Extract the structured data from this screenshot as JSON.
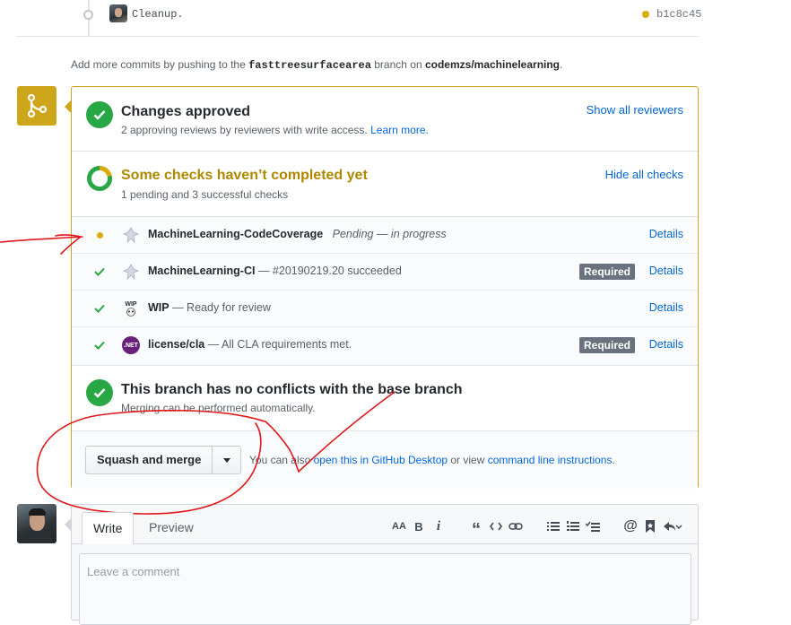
{
  "commit": {
    "message": "Cleanup.",
    "sha": "b1c8c45"
  },
  "add_commits": {
    "prefix": "Add more commits by pushing to the ",
    "branch": "fasttreesurfacearea",
    "middle": " branch on ",
    "repo": "codemzs/machinelearning",
    "suffix": "."
  },
  "review": {
    "title": "Changes approved",
    "subtitle": "2 approving reviews by reviewers with write access.",
    "learn_more": "Learn more.",
    "show_link": "Show all reviewers"
  },
  "checks": {
    "title": "Some checks haven’t completed yet",
    "subtitle": "1 pending and 3 successful checks",
    "hide_link": "Hide all checks",
    "items": [
      {
        "name": "MachineLearning-CodeCoverage",
        "desc": "Pending — in progress",
        "status": "pending",
        "required": "",
        "details": "Details"
      },
      {
        "name": "MachineLearning-CI",
        "desc": " — #20190219.20 succeeded",
        "status": "success",
        "required": "Required",
        "details": "Details"
      },
      {
        "name": "WIP",
        "desc": " — Ready for review",
        "status": "success",
        "required": "",
        "details": "Details"
      },
      {
        "name": "license/cla",
        "desc": " — All CLA requirements met.",
        "status": "success",
        "required": "Required",
        "details": "Details"
      }
    ],
    "wip_avatar_text": "WIP",
    "net_avatar_text": ".NET"
  },
  "conflicts": {
    "title": "This branch has no conflicts with the base branch",
    "subtitle": "Merging can be performed automatically."
  },
  "merge": {
    "button": "Squash and merge",
    "alt_prefix": "You can also ",
    "open_desktop": "open this in GitHub Desktop",
    "alt_middle": " or view ",
    "cli": "command line instructions",
    "alt_suffix": "."
  },
  "comment": {
    "tab_write": "Write",
    "tab_preview": "Preview",
    "placeholder": "Leave a comment",
    "toolbar": [
      "header-icon",
      "bold-icon",
      "italic-icon",
      "quote-icon",
      "code-icon",
      "link-icon",
      "unordered-list-icon",
      "ordered-list-icon",
      "task-list-icon",
      "mention-icon",
      "bookmark-icon",
      "reply-icon"
    ],
    "header_glyph": "AA",
    "bold_glyph": "B",
    "italic_glyph": "i",
    "quote_glyph": "“"
  },
  "colors": {
    "success": "#28a745",
    "pending": "#dbab09",
    "merge_border": "#cea61b",
    "link": "#0366d6",
    "annotation": "#e0191b"
  }
}
